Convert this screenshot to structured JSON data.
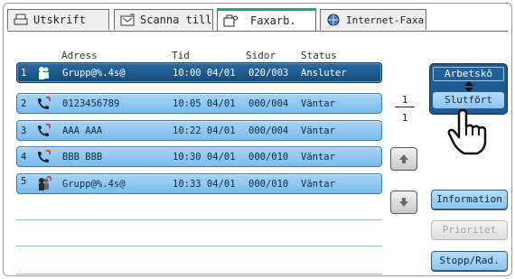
{
  "tabs": [
    {
      "label": "Utskrift",
      "icon": "printer-icon",
      "active": false
    },
    {
      "label": "Scanna till",
      "icon": "scan-icon",
      "active": false
    },
    {
      "label": "Faxarb.",
      "icon": "fax-icon",
      "active": true
    },
    {
      "label": "Internet-Faxa",
      "icon": "globe-icon",
      "active": false
    }
  ],
  "columns": {
    "address": "Adress",
    "time": "Tid",
    "pages": "Sidor",
    "status": "Status"
  },
  "jobs": [
    {
      "index": "1",
      "icon": "group-icon",
      "address": "Grupp@%.4s@",
      "time": "10:00 04/01",
      "pages": "020/003",
      "status": "Ansluter",
      "selected": true
    },
    {
      "index": "2",
      "icon": "phone-icon",
      "address": "0123456789",
      "time": "10:05 04/01",
      "pages": "000/004",
      "status": "Väntar",
      "selected": false
    },
    {
      "index": "3",
      "icon": "phone-icon",
      "address": "AAA AAA",
      "time": "10:22 04/01",
      "pages": "000/004",
      "status": "Väntar",
      "selected": false
    },
    {
      "index": "4",
      "icon": "phone-icon",
      "address": "BBB BBB",
      "time": "10:30 04/01",
      "pages": "000/010",
      "status": "Väntar",
      "selected": false
    },
    {
      "index": "5",
      "icon": "group-icon",
      "address": "Grupp@%.4s@",
      "time": "10:33 04/01",
      "pages": "000/010",
      "status": "Väntar",
      "selected": false
    }
  ],
  "pager": {
    "current": "1",
    "total": "1"
  },
  "queue_toggle": {
    "top_label": "Arbetskö",
    "bottom_label": "Slutfört"
  },
  "side_buttons": {
    "information": "Information",
    "priority": "Prioritet",
    "stop_delete": "Stopp/Rad."
  },
  "colors": {
    "selected_row": "#164b7a",
    "row": "#8cc5ef",
    "active_tab_accent": "#22aa66"
  }
}
